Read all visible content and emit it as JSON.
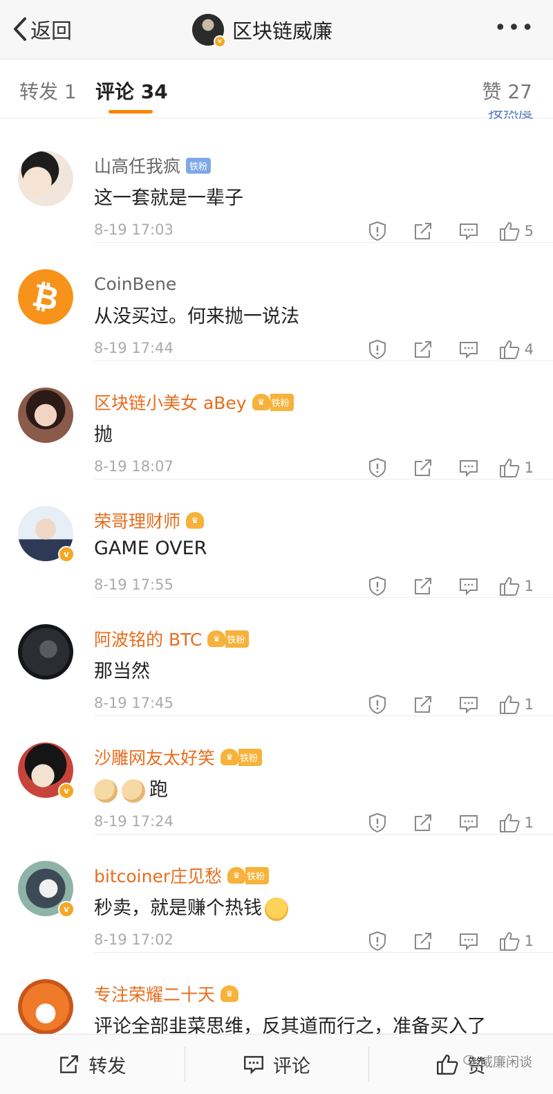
{
  "header": {
    "back_label": "返回",
    "title": "区块链威廉",
    "more": "•••"
  },
  "tabs": [
    {
      "label": "转发 1"
    },
    {
      "label": "评论 34",
      "active": true
    },
    {
      "label": "赞 27"
    }
  ],
  "sort_hint": "按热度",
  "comments": [
    {
      "name": "山高任我疯",
      "badge": "铁粉",
      "text": "这一套就是一辈子",
      "time": "8-19 17:03",
      "likes": "5"
    },
    {
      "name": "CoinBene",
      "text": "从没买过。何来抛一说法",
      "time": "8-19 17:44",
      "likes": "4"
    },
    {
      "name": "区块链小美女 aBey",
      "badge": "铁粉",
      "text": "抛",
      "time": "8-19 18:07",
      "likes": "1"
    },
    {
      "name": "荣哥理财师",
      "text": "GAME OVER",
      "time": "8-19 17:55",
      "likes": "1"
    },
    {
      "name": "阿波铭的 BTC",
      "badge": "铁粉",
      "text": "那当然",
      "time": "8-19 17:45",
      "likes": "1"
    },
    {
      "name": "沙雕网友太好笑",
      "badge": "铁粉",
      "text": "跑",
      "time": "8-19 17:24",
      "likes": "1"
    },
    {
      "name": "bitcoiner庄见愁",
      "badge": "铁粉",
      "text": "秒卖，就是赚个热钱",
      "time": "8-19 17:02",
      "likes": "1"
    },
    {
      "name": "专注荣耀二十天",
      "text": "评论全部韭菜思维，反其道而行之，准备买入了"
    }
  ],
  "bottom": {
    "repost": "转发",
    "comment": "评论",
    "like": "赞"
  },
  "watermark": "威廉闲谈",
  "colors": {
    "accent": "#ff8200",
    "vip_name": "#e86c1b",
    "fan_badge": "#7fa8e8"
  }
}
